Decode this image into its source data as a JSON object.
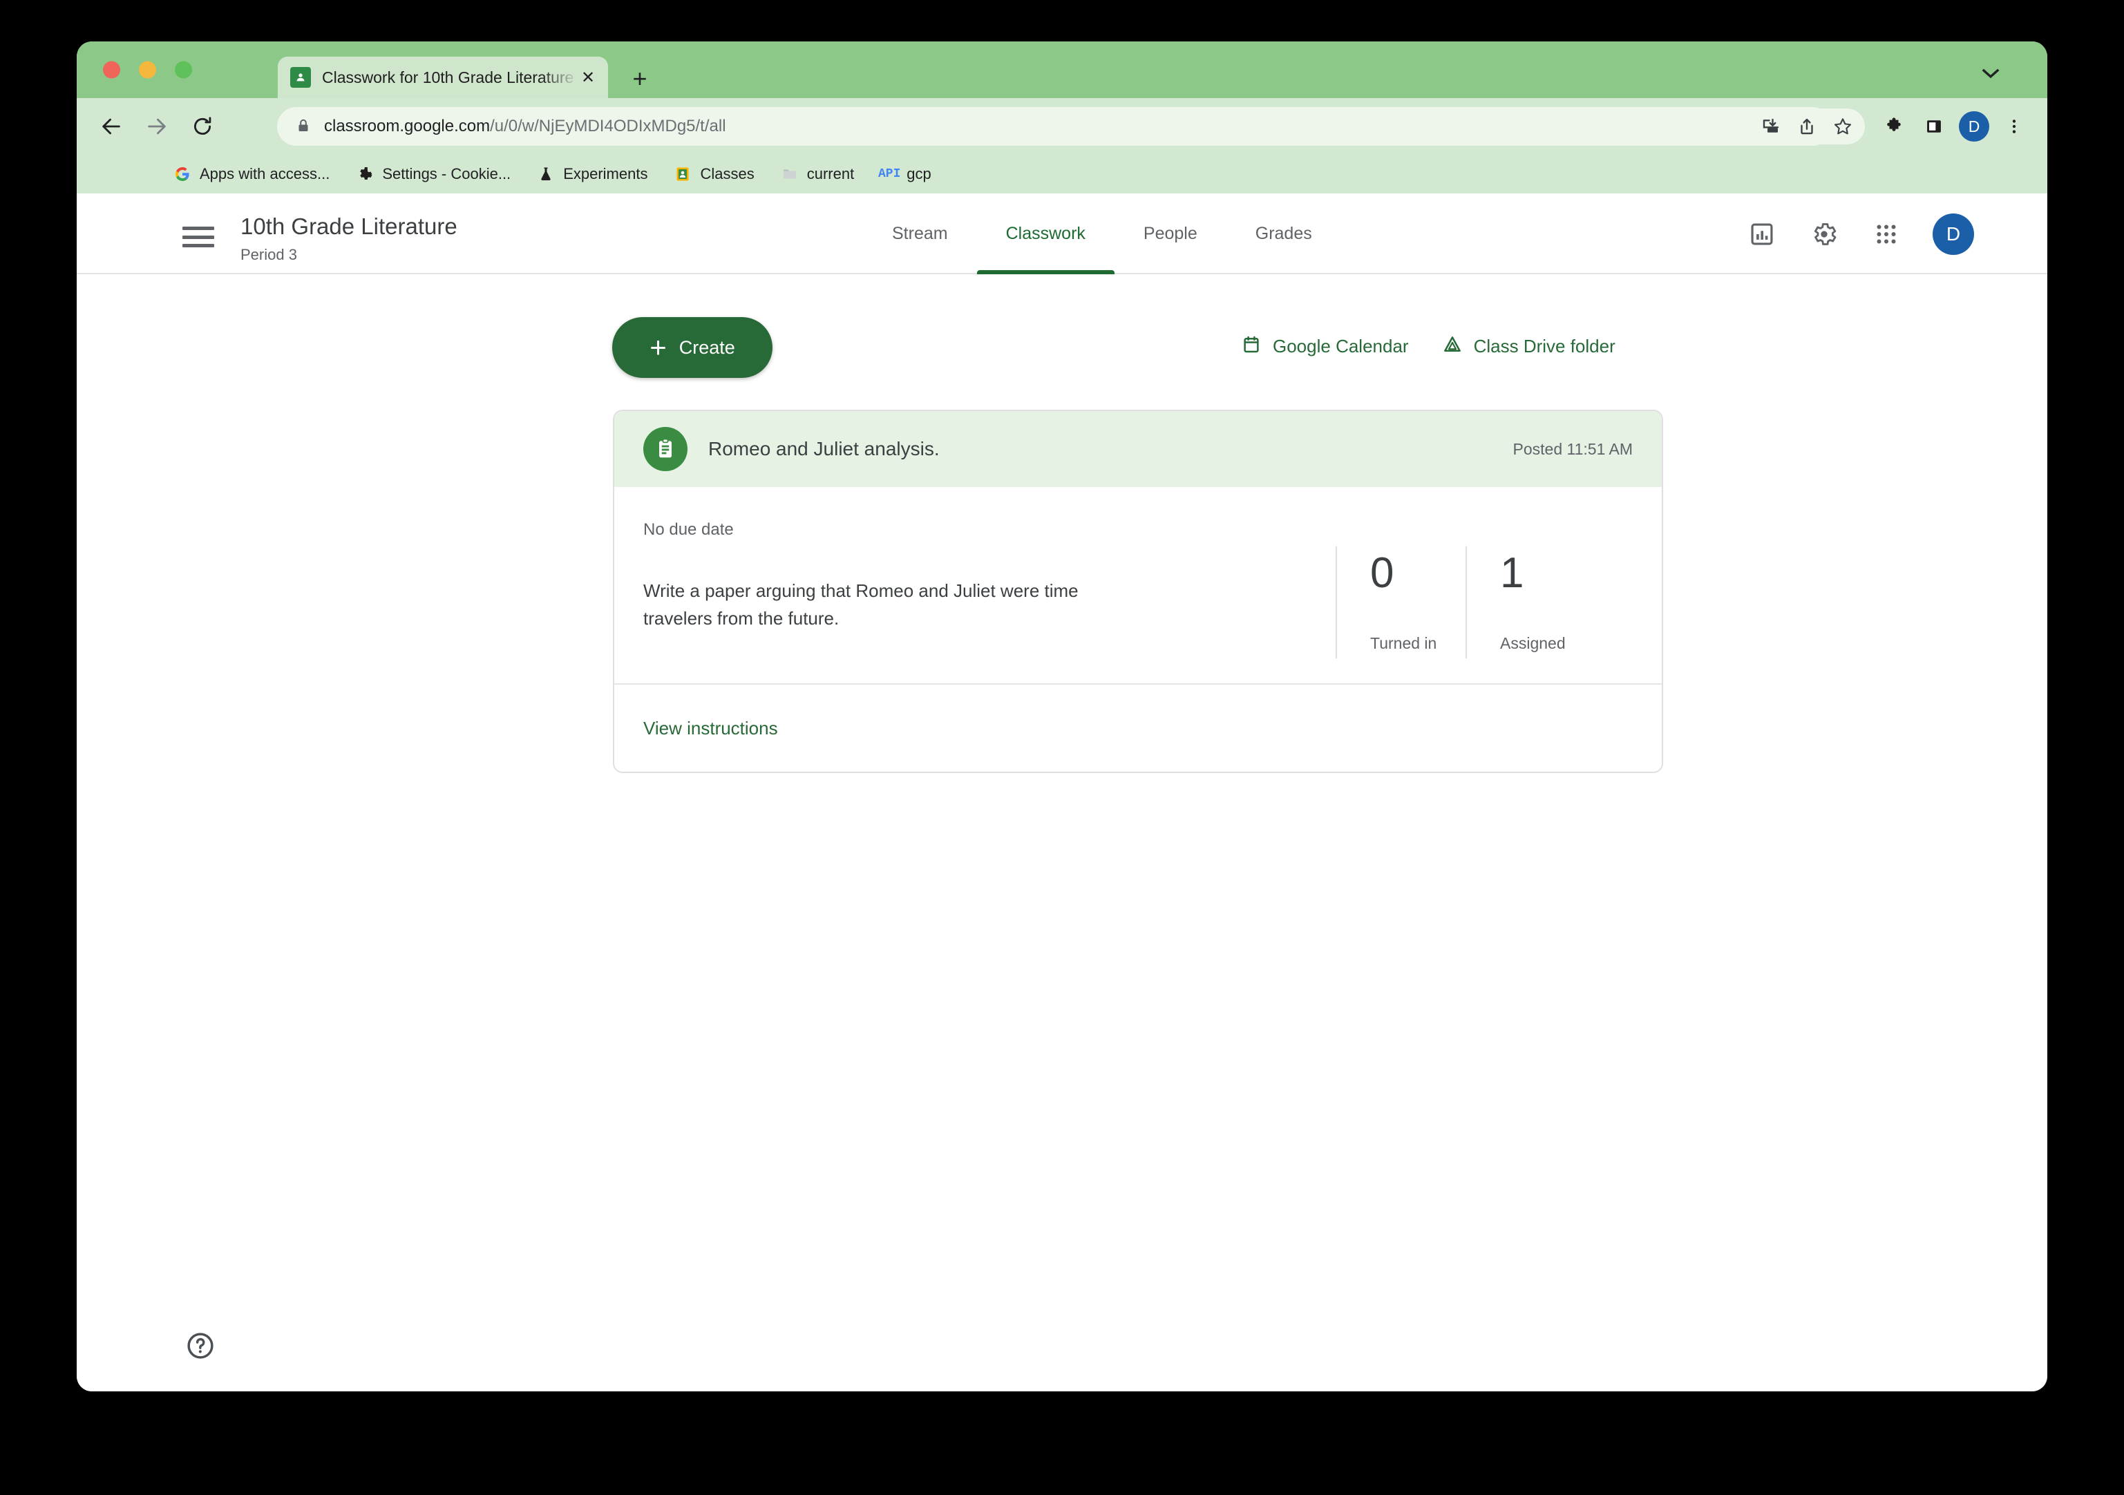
{
  "browser": {
    "tab": {
      "title": "Classwork for 10th Grade Literature",
      "favicon_icon": "google-classroom-icon",
      "close_icon": "close-icon"
    },
    "new_tab_icon": "plus-icon",
    "tab_search_icon": "chevron-down-icon",
    "nav": {
      "back_icon": "back-arrow-icon",
      "forward_icon": "forward-arrow-icon",
      "reload_icon": "reload-icon"
    },
    "omnibox": {
      "lock_icon": "lock-icon",
      "url_domain": "classroom.google.com",
      "url_path": "/u/0/w/NjEyMDI4ODIxMDg5/t/all"
    },
    "toolbar_icons": [
      {
        "name": "install-app-icon"
      },
      {
        "name": "share-icon"
      },
      {
        "name": "bookmark-star-icon"
      },
      {
        "name": "extensions-puzzle-icon"
      },
      {
        "name": "side-panel-icon"
      },
      {
        "name": "chrome-profile-avatar",
        "label": "D"
      },
      {
        "name": "chrome-menu-icon"
      }
    ],
    "bookmarks": [
      {
        "label": "Apps with access...",
        "icon": "google-g-icon"
      },
      {
        "label": "Settings - Cookie...",
        "icon": "gear-icon"
      },
      {
        "label": "Experiments",
        "icon": "flask-icon"
      },
      {
        "label": "Classes",
        "icon": "google-classroom-icon"
      },
      {
        "label": "current",
        "icon": "folder-icon"
      },
      {
        "label": "gcp",
        "icon": "api-icon"
      }
    ]
  },
  "classroom": {
    "menu_icon": "hamburger-menu-icon",
    "class_title": "10th Grade Literature",
    "class_section": "Period 3",
    "tabs": [
      {
        "label": "Stream",
        "active": false
      },
      {
        "label": "Classwork",
        "active": true
      },
      {
        "label": "People",
        "active": false
      },
      {
        "label": "Grades",
        "active": false
      }
    ],
    "header_actions": [
      {
        "name": "insights-chart-icon"
      },
      {
        "name": "gear-icon"
      },
      {
        "name": "apps-grid-icon"
      }
    ],
    "account_avatar_letter": "D",
    "create_button": {
      "label": "Create",
      "plus": "+"
    },
    "quick_links": [
      {
        "label": "Google Calendar",
        "icon": "calendar-icon"
      },
      {
        "label": "Class Drive folder",
        "icon": "google-drive-icon"
      }
    ],
    "assignment": {
      "icon": "assignment-clipboard-icon",
      "title": "Romeo and Juliet analysis.",
      "posted": "Posted 11:51 AM",
      "due": "No due date",
      "description": "Write a paper arguing that Romeo and Juliet were time travelers from the future.",
      "stats": [
        {
          "count": "0",
          "label": "Turned in"
        },
        {
          "count": "1",
          "label": "Assigned"
        }
      ],
      "view_instructions": "View instructions"
    },
    "help_icon": "help-circle-icon"
  },
  "colors": {
    "accent_green": "#276a37",
    "tabstrip_green": "#8cc888",
    "toolbar_green": "#d3e8d0",
    "card_header_green": "#e6f2e4",
    "avatar_blue": "#1a5fa8"
  }
}
